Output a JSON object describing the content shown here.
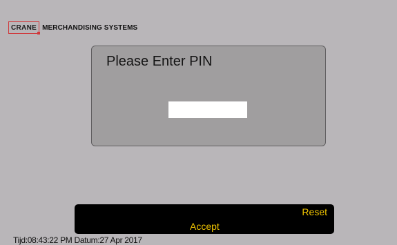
{
  "brand": {
    "logo_text": "CRANE",
    "company_name": "MERCHANDISING SYSTEMS"
  },
  "pin_dialog": {
    "title": "Please Enter PIN",
    "input_value": ""
  },
  "actions": {
    "reset_label": "Reset",
    "accept_label": "Accept"
  },
  "status": {
    "text": "Tijd:08:43:22 PM Datum:27 Apr 2017"
  },
  "colors": {
    "background": "#b9b6b9",
    "dialog_bg": "#a09e9f",
    "action_bar": "#000000",
    "action_text": "#f0c400",
    "logo_border": "#d0383b"
  }
}
